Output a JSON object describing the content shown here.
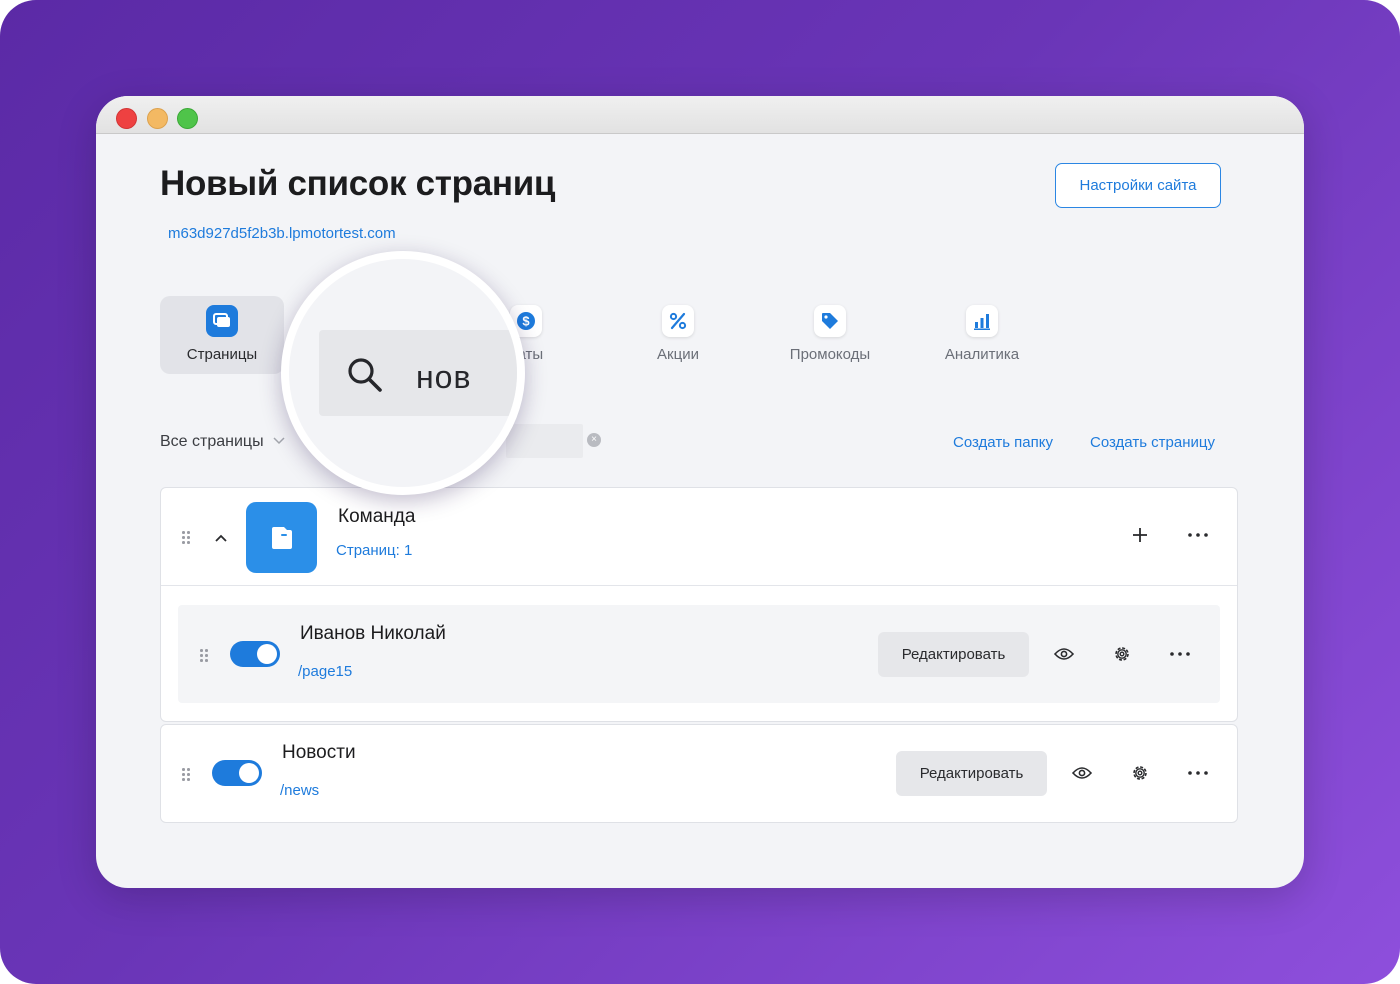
{
  "header": {
    "title": "Новый список страниц",
    "site_url": "m63d927d5f2b3b.lpmotortest.com",
    "settings_button": "Настройки сайта"
  },
  "nav": {
    "items": [
      {
        "label": "Страницы",
        "icon": "pages-icon",
        "active": true
      },
      {
        "label": "Оплаты",
        "icon": "dollar-icon",
        "active": false
      },
      {
        "label": "Акции",
        "icon": "percent-icon",
        "active": false
      },
      {
        "label": "Промокоды",
        "icon": "tag-icon",
        "active": false
      },
      {
        "label": "Аналитика",
        "icon": "chart-icon",
        "active": false
      }
    ],
    "partial_visible_label": "латы"
  },
  "filter": {
    "label": "Все страницы",
    "search_value": "нов",
    "create_folder": "Создать папку",
    "create_page": "Создать страницу"
  },
  "folder": {
    "title": "Команда",
    "subtitle": "Страниц: 1"
  },
  "pages": [
    {
      "title": "Иванов Николай",
      "path": "/page15",
      "enabled": true,
      "edit_label": "Редактировать"
    },
    {
      "title": "Новости",
      "path": "/news",
      "enabled": true,
      "edit_label": "Редактировать"
    }
  ],
  "colors": {
    "accent": "#1e7bdc",
    "background_gradient_start": "#5b2aa6",
    "background_gradient_end": "#8e4fdc"
  }
}
